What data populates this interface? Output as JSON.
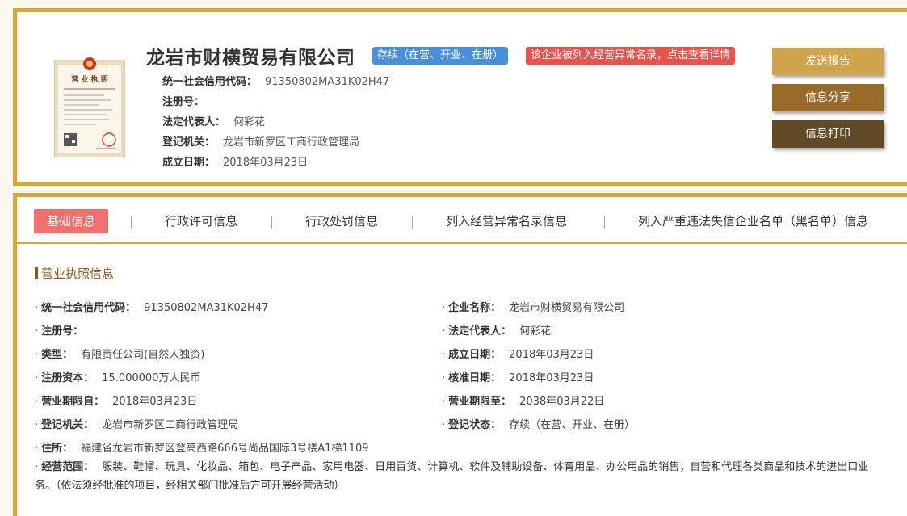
{
  "company": {
    "name": "龙岩市财横贸易有限公司",
    "status_badge": "存续（在营、开业、在册）",
    "abnormal_badge": "该企业被列入经营异常名录，点击查看详情",
    "license_image_title": "营业执照"
  },
  "summary": [
    {
      "label": "统一社会信用代码：",
      "value": "91350802MA31K02H47"
    },
    {
      "label": "注册号：",
      "value": ""
    },
    {
      "label": "法定代表人：",
      "value": "何彩花"
    },
    {
      "label": "登记机关：",
      "value": "龙岩市新罗区工商行政管理局"
    },
    {
      "label": "成立日期：",
      "value": "2018年03月23日"
    }
  ],
  "actions": {
    "report": "发送报告",
    "share": "信息分享",
    "print": "信息打印"
  },
  "tabs": [
    "基础信息",
    "行政许可信息",
    "行政处罚信息",
    "列入经营异常名录信息",
    "列入严重违法失信企业名单（黑名单）信息"
  ],
  "section_title": "营业执照信息",
  "fields": {
    "credit_code": {
      "label": "统一社会信用代码：",
      "value": "91350802MA31K02H47"
    },
    "company_name": {
      "label": "企业名称：",
      "value": "龙岩市财横贸易有限公司"
    },
    "reg_no": {
      "label": "注册号：",
      "value": ""
    },
    "legal_rep": {
      "label": "法定代表人：",
      "value": "何彩花"
    },
    "type": {
      "label": "类型：",
      "value": "有限责任公司(自然人独资)"
    },
    "established": {
      "label": "成立日期：",
      "value": "2018年03月23日"
    },
    "capital": {
      "label": "注册资本：",
      "value": "15.000000万人民币"
    },
    "approved": {
      "label": "核准日期：",
      "value": "2018年03月23日"
    },
    "term_from": {
      "label": "营业期限自：",
      "value": "2018年03月23日"
    },
    "term_to": {
      "label": "营业期限至：",
      "value": "2038年03月22日"
    },
    "authority": {
      "label": "登记机关：",
      "value": "龙岩市新罗区工商行政管理局"
    },
    "reg_status": {
      "label": "登记状态：",
      "value": "存续（在营、开业、在册）"
    },
    "address": {
      "label": "住所：",
      "value": "福建省龙岩市新罗区登高西路666号尚品国际3号楼A1梯1109"
    },
    "scope": {
      "label": "经营范围：",
      "value": "服装、鞋帽、玩具、化妆品、箱包、电子产品、家用电器、日用百货、计算机、软件及辅助设备、体育用品、办公用品的销售；自营和代理各类商品和技术的进出口业务。（依法须经批准的项目，经相关部门批准后方可开展经营活动）"
    }
  }
}
